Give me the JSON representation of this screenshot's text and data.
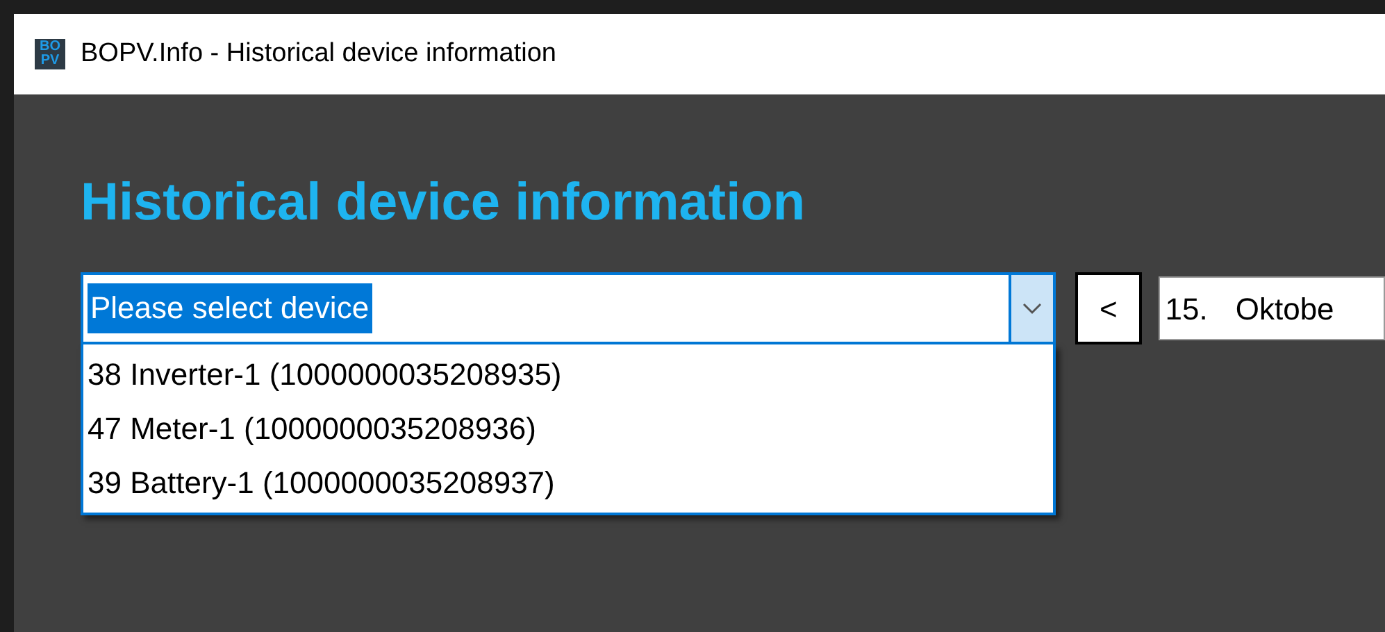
{
  "window": {
    "logo_top": "BO",
    "logo_bottom": "PV",
    "title": "BOPV.Info - Historical device information"
  },
  "heading": "Historical device information",
  "device_select": {
    "value": "Please select device",
    "expanded": true,
    "options": [
      {
        "label": "38 Inverter-1 (1000000035208935)",
        "selected": false
      },
      {
        "label": "47 Meter-1 (1000000035208936)",
        "selected": false
      },
      {
        "label": "39 Battery-1 (1000000035208937)",
        "selected": false
      }
    ]
  },
  "prev_button": "<",
  "date_field": {
    "day": "15.",
    "month": "Oktobe"
  }
}
